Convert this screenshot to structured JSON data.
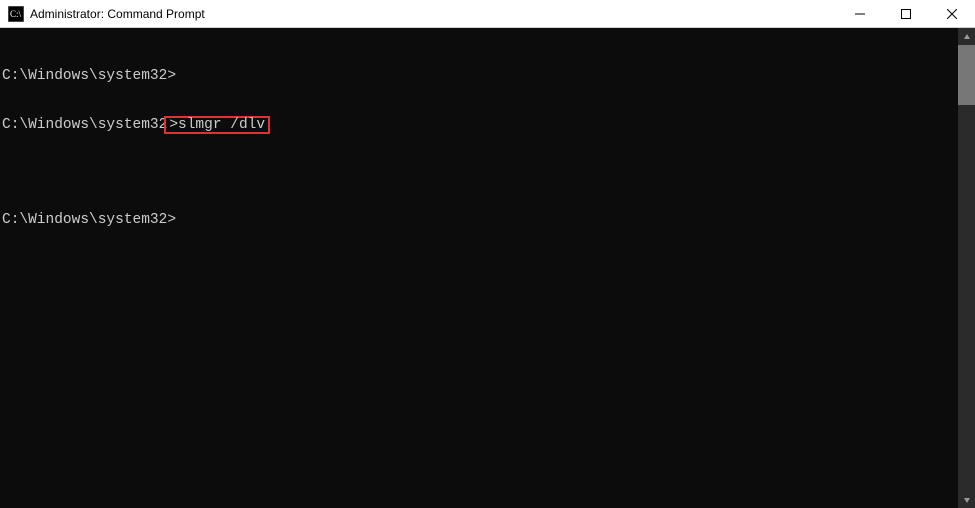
{
  "window": {
    "title": "Administrator: Command Prompt"
  },
  "terminal": {
    "lines": [
      {
        "prompt": "C:\\Windows\\system32>",
        "command": "",
        "highlight": false
      },
      {
        "prompt": "C:\\Windows\\system32",
        "command": ">slmgr /dlv",
        "highlight": true
      },
      {
        "prompt": "",
        "command": "",
        "highlight": false
      },
      {
        "prompt": "C:\\Windows\\system32>",
        "command": "",
        "highlight": false
      }
    ]
  }
}
